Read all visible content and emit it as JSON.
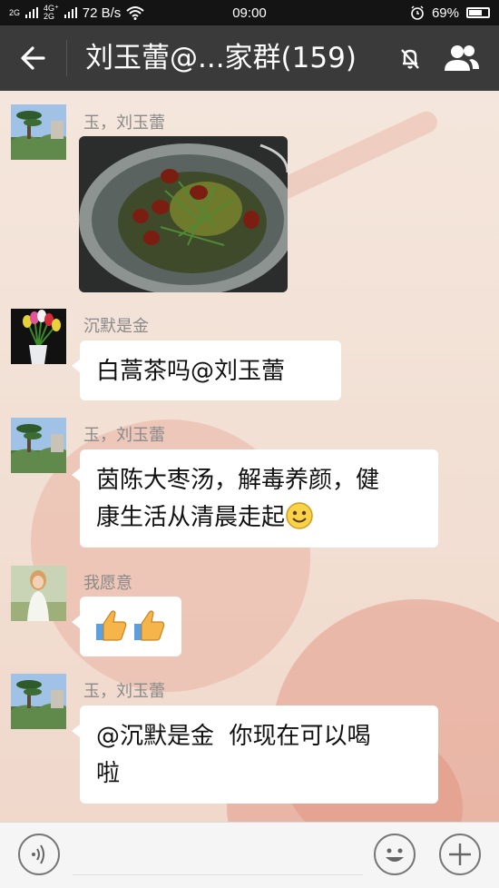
{
  "status_bar": {
    "signal1": "2G",
    "signal2": "4G⁺\n2G",
    "net_speed": "72 B/s",
    "time": "09:00",
    "battery_percent": "69%",
    "battery_level": 0.69
  },
  "header": {
    "title": "刘玉蕾@...家群(159)",
    "mute_icon": "bell-off-icon",
    "group_icon": "group-members-icon",
    "back_icon": "arrow-left-icon"
  },
  "messages": [
    {
      "sender": "玉，刘玉蕾",
      "type": "image",
      "image_desc": "pot-soup-photo"
    },
    {
      "sender": "沉默是金",
      "type": "text",
      "text": "白蒿茶吗@刘玉蕾"
    },
    {
      "sender": "玉，刘玉蕾",
      "type": "text",
      "lines": [
        "茵陈大枣汤，解毒养颜，健",
        "康生活从清晨走起"
      ],
      "emoji": "smile-emoji"
    },
    {
      "sender": "我愿意",
      "type": "emoji",
      "emoji": "thumbs-up-emoji"
    },
    {
      "sender": "玉，刘玉蕾",
      "type": "text",
      "lines": [
        "@沉默是金  你现在可以喝",
        "啦"
      ]
    }
  ],
  "input_bar": {
    "voice_icon": "voice-icon",
    "emoji_icon": "emoji-face-icon",
    "plus_icon": "plus-icon"
  },
  "colors": {
    "header_bg": "#3a3a3a",
    "status_bg": "#141414",
    "sender_text": "#8a8a8a",
    "bubble_bg": "#ffffff"
  }
}
